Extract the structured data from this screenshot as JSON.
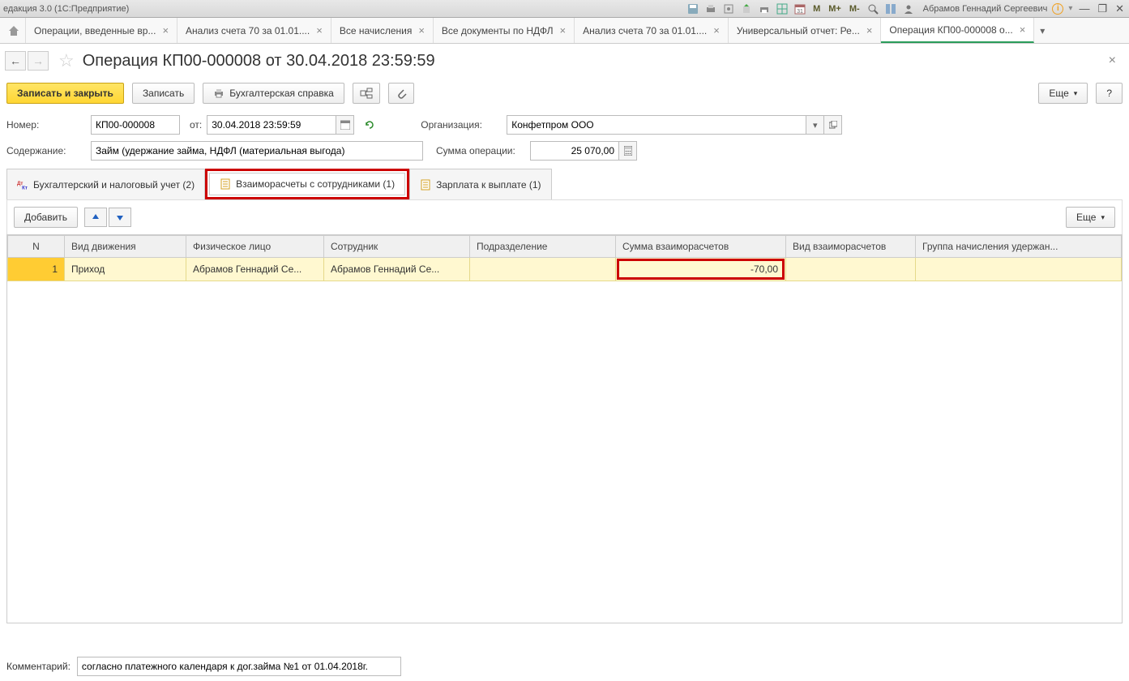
{
  "titlebar": {
    "title": "едакция 3.0  (1С:Предприятие)",
    "m": "M",
    "mplus": "M+",
    "mminus": "M-",
    "username": "Абрамов Геннадий Сергеевич"
  },
  "tabs": [
    {
      "label": "Операции, введенные вр..."
    },
    {
      "label": "Анализ счета 70 за 01.01...."
    },
    {
      "label": "Все начисления"
    },
    {
      "label": "Все документы по НДФЛ"
    },
    {
      "label": "Анализ счета 70 за 01.01...."
    },
    {
      "label": "Универсальный отчет: Ре..."
    },
    {
      "label": "Операция КП00-000008 о...",
      "active": true
    }
  ],
  "page": {
    "title": "Операция КП00-000008 от 30.04.2018 23:59:59"
  },
  "toolbar": {
    "save_close": "Записать и закрыть",
    "save": "Записать",
    "accounting_ref": "Бухгалтерская справка",
    "more": "Еще",
    "help": "?"
  },
  "form": {
    "number_label": "Номер:",
    "number_value": "КП00-000008",
    "from_label": "от:",
    "date_value": "30.04.2018 23:59:59",
    "org_label": "Организация:",
    "org_value": "Конфетпром ООО",
    "content_label": "Содержание:",
    "content_value": "Займ (удержание займа, НДФЛ (материальная выгода)",
    "sum_label": "Сумма операции:",
    "sum_value": "25 070,00"
  },
  "inner_tabs": [
    {
      "label": "Бухгалтерский и налоговый учет (2)",
      "icon": "dtkt"
    },
    {
      "label": "Взаиморасчеты с сотрудниками (1)",
      "icon": "doc",
      "active": true,
      "highlight": true
    },
    {
      "label": "Зарплата к выплате (1)",
      "icon": "doc"
    }
  ],
  "grid_toolbar": {
    "add": "Добавить",
    "more": "Еще"
  },
  "grid": {
    "columns": [
      "N",
      "Вид движения",
      "Физическое лицо",
      "Сотрудник",
      "Подразделение",
      "Сумма взаиморасчетов",
      "Вид взаиморасчетов",
      "Группа начисления удержан..."
    ],
    "rows": [
      {
        "n": "1",
        "movement": "Приход",
        "person": "Абрамов Геннадий Се...",
        "employee": "Абрамов Геннадий Се...",
        "department": "",
        "amount": "-70,00",
        "kind": "",
        "group": "",
        "amount_highlight": true
      }
    ]
  },
  "comment": {
    "label": "Комментарий:",
    "value": "согласно платежного календаря к дог.займа №1 от 01.04.2018г."
  }
}
